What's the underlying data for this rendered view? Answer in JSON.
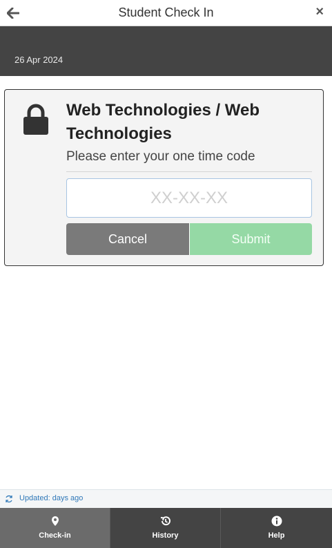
{
  "header": {
    "title": "Student Check In",
    "back_icon": "arrow-left-icon",
    "close_label": "×"
  },
  "date_bar": {
    "date": "26 Apr 2024"
  },
  "checkin_card": {
    "icon": "lock-icon",
    "course": "Web Technologies / Web Technologies",
    "prompt": "Please enter your one time code",
    "code_placeholder": "XX-XX-XX",
    "code_value": "",
    "cancel_label": "Cancel",
    "submit_label": "Submit"
  },
  "status": {
    "updated_label": "Updated:",
    "updated_value": "days ago"
  },
  "tabs": [
    {
      "label": "Check-in",
      "icon": "map-pin-icon",
      "active": true
    },
    {
      "label": "History",
      "icon": "history-icon",
      "active": false
    },
    {
      "label": "Help",
      "icon": "info-icon",
      "active": false
    }
  ],
  "colors": {
    "dark_bar": "#444444",
    "card_bg": "#f4f4f4",
    "cancel_bg": "#7a7a7a",
    "submit_bg": "#95d9a5",
    "link_blue": "#2f78b8",
    "active_tab": "#6b6b6b"
  }
}
